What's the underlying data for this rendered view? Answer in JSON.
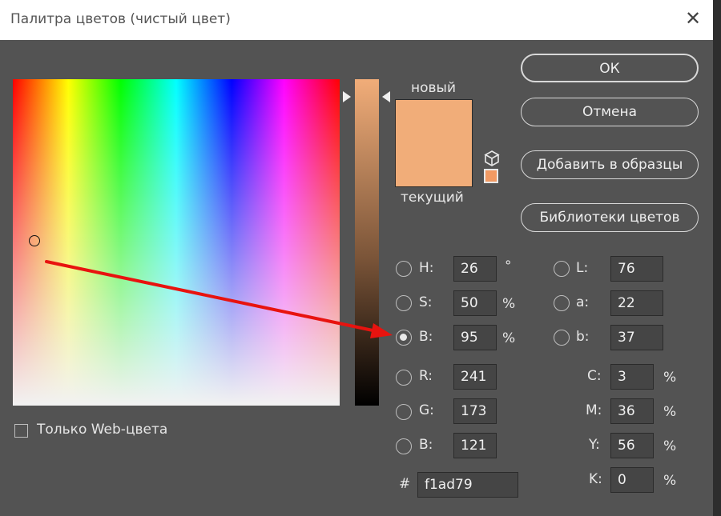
{
  "window": {
    "title": "Палитра цветов (чистый цвет)"
  },
  "preview": {
    "new_label": "новый",
    "current_label": "текущий"
  },
  "buttons": {
    "ok": "ОК",
    "cancel": "Отмена",
    "add_swatch": "Добавить в образцы",
    "libraries": "Библиотеки цветов"
  },
  "hsb": [
    {
      "label": "H:",
      "value": "26",
      "unit": "°",
      "selected": false
    },
    {
      "label": "S:",
      "value": "50",
      "unit": "%",
      "selected": false
    },
    {
      "label": "B:",
      "value": "95",
      "unit": "%",
      "selected": true
    }
  ],
  "rgb": [
    {
      "label": "R:",
      "value": "241"
    },
    {
      "label": "G:",
      "value": "173"
    },
    {
      "label": "B:",
      "value": "121"
    }
  ],
  "lab": [
    {
      "label": "L:",
      "value": "76"
    },
    {
      "label": "a:",
      "value": "22"
    },
    {
      "label": "b:",
      "value": "37"
    }
  ],
  "cmyk": [
    {
      "label": "C:",
      "value": "3",
      "unit": "%"
    },
    {
      "label": "M:",
      "value": "36",
      "unit": "%"
    },
    {
      "label": "Y:",
      "value": "56",
      "unit": "%"
    },
    {
      "label": "K:",
      "value": "0",
      "unit": "%"
    }
  ],
  "hex": {
    "prefix": "#",
    "value": "f1ad79"
  },
  "web_only": {
    "label": "Только Web-цвета",
    "checked": false
  },
  "colors": {
    "current": "#f1ad79",
    "annotation_arrow": "#e8130f",
    "dialog_bg": "#535353"
  },
  "icons": {
    "close": "close-icon",
    "cube": "cube-icon",
    "gamut_warning": "gamut-swatch"
  }
}
